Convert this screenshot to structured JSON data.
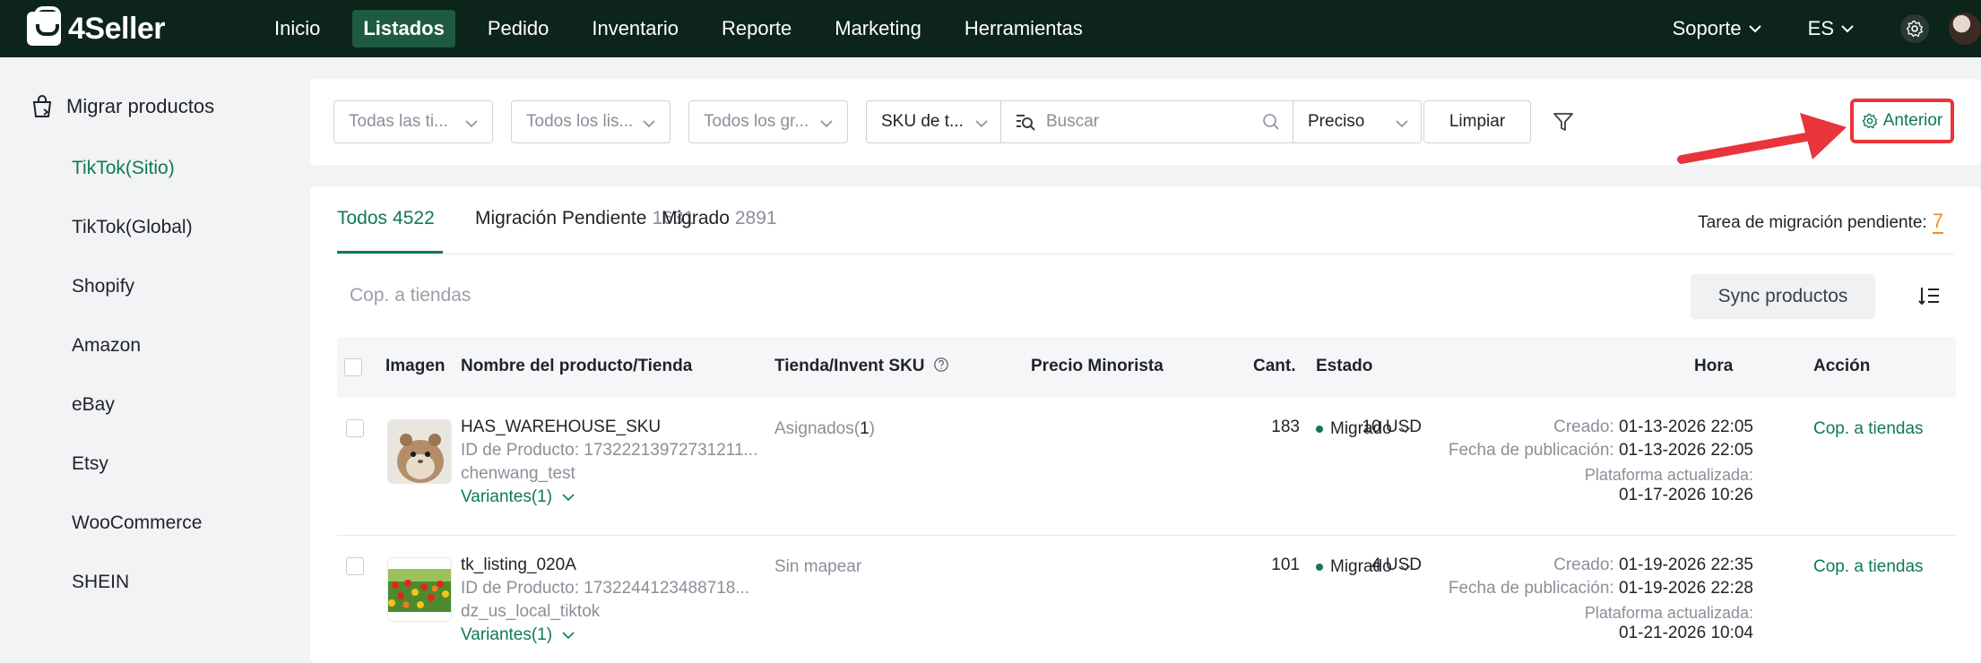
{
  "brand": {
    "name": "4Seller"
  },
  "nav": {
    "items": [
      "Inicio",
      "Listados",
      "Pedido",
      "Inventario",
      "Reporte",
      "Marketing",
      "Herramientas"
    ],
    "active": "Listados",
    "support": "Soporte",
    "language": "ES"
  },
  "sidebar": {
    "heading": "Migrar productos",
    "items": [
      "TikTok(Sitio)",
      "TikTok(Global)",
      "Shopify",
      "Amazon",
      "eBay",
      "Etsy",
      "WooCommerce",
      "SHEIN"
    ],
    "active": "TikTok(Sitio)"
  },
  "filters": {
    "store_select": "Todas las ti...",
    "listing_select": "Todos los lis...",
    "group_select": "Todos los gr...",
    "sku_type": "SKU de t...",
    "search_placeholder": "Buscar",
    "match_mode": "Preciso",
    "clear_label": "Limpiar",
    "previous_label": "Anterior"
  },
  "tabs": [
    {
      "label": "Todos",
      "count": "4522"
    },
    {
      "label": "Migración Pendiente",
      "count": "1631"
    },
    {
      "label": "Migrado",
      "count": "2891"
    }
  ],
  "pending_task": {
    "label": "Tarea de migración pendiente:",
    "count": "7"
  },
  "toolbar": {
    "copy_to_stores": "Cop. a tiendas",
    "sync_label": "Sync productos"
  },
  "table": {
    "headers": {
      "image": "Imagen",
      "name": "Nombre del producto/Tienda",
      "store_sku": "Tienda/Invent SKU",
      "price": "Precio Minorista",
      "qty": "Cant.",
      "status": "Estado",
      "time": "Hora",
      "action": "Acción"
    },
    "rows": [
      {
        "title": "HAS_WAREHOUSE_SKU",
        "product_id": "ID de Producto: 17322213972731211...",
        "store": "chenwang_test",
        "variants": "Variantes(1)",
        "sku_prefix": "Asignados(",
        "sku_count": "1",
        "sku_suffix": ")",
        "price": "10 USD",
        "qty": "183",
        "status": "Migrado",
        "created_label": "Creado:",
        "created": "01-13-2026 22:05",
        "published_label": "Fecha de publicación:",
        "published": "01-13-2026 22:05",
        "updated_label": "Plataforma actualizada:",
        "updated": "01-17-2026 10:26",
        "action": "Cop. a tiendas"
      },
      {
        "title": "tk_listing_020A",
        "product_id": "ID de Producto: 1732244123488718...",
        "store": "dz_us_local_tiktok",
        "variants": "Variantes(1)",
        "sku_text": "Sin mapear",
        "price": "4 USD",
        "qty": "101",
        "status": "Migrado",
        "created_label": "Creado:",
        "created": "01-19-2026 22:35",
        "published_label": "Fecha de publicación:",
        "published": "01-19-2026 22:28",
        "updated_label": "Plataforma actualizada:",
        "updated": "01-21-2026 10:04",
        "action": "Cop. a tiendas"
      }
    ]
  }
}
